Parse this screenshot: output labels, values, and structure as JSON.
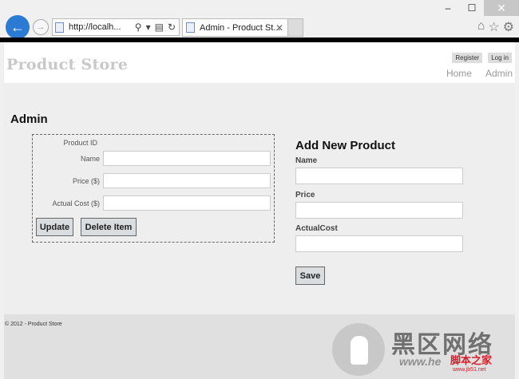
{
  "browser": {
    "url": "http://localh...",
    "tab_title": "Admin - Product St...",
    "minimize": "–",
    "maximize": "☐",
    "close": "✕",
    "back": "←",
    "forward": "→",
    "tab_close": "✕",
    "search_glyph": "⚲",
    "dropdown_glyph": "▾",
    "compat_glyph": "▤",
    "refresh_glyph": "↻",
    "home_glyph": "⌂",
    "star_glyph": "☆",
    "gear_glyph": "⚙"
  },
  "site": {
    "title": "Product Store",
    "register": "Register",
    "login": "Log in",
    "nav": [
      "Home",
      "Admin"
    ]
  },
  "admin": {
    "title": "Admin",
    "edit": {
      "product_id_label": "Product ID",
      "name_label": "Name",
      "price_label": "Price ($)",
      "cost_label": "Actual Cost ($)",
      "name_value": "",
      "price_value": "",
      "cost_value": "",
      "update_label": "Update",
      "delete_label": "Delete Item"
    },
    "add": {
      "title": "Add New Product",
      "name_label": "Name",
      "price_label": "Price",
      "cost_label": "ActualCost",
      "name_value": "",
      "price_value": "",
      "cost_value": "",
      "save_label": "Save"
    }
  },
  "footer": {
    "text": "© 2012 - Product Store"
  },
  "watermark": {
    "big": "黑区网络",
    "small": "www.he",
    "red": "脚本之家",
    "tiny": "www.jb51.net"
  }
}
